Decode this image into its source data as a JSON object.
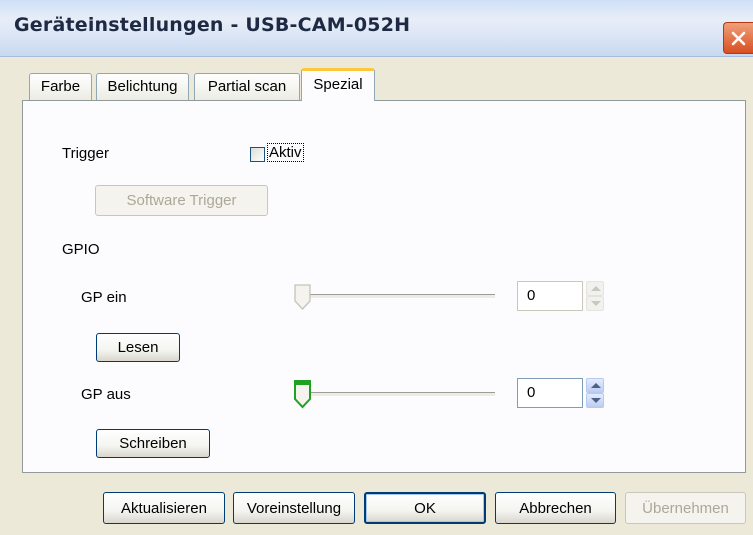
{
  "window": {
    "title": "Geräteinstellungen - USB-CAM-052H"
  },
  "tabs": [
    {
      "label": "Farbe"
    },
    {
      "label": "Belichtung"
    },
    {
      "label": "Partial scan"
    },
    {
      "label": "Spezial"
    }
  ],
  "active_tab": "Spezial",
  "trigger": {
    "label": "Trigger",
    "checkbox_label": "Aktiv",
    "checked": false,
    "software_trigger_button": "Software Trigger"
  },
  "gpio": {
    "label": "GPIO",
    "gp_ein": {
      "label": "GP ein",
      "value": "0",
      "button": "Lesen",
      "slider_level": 0
    },
    "gp_aus": {
      "label": "GP aus",
      "value": "0",
      "button": "Schreiben",
      "slider_level": 0
    }
  },
  "footer": {
    "refresh": "Aktualisieren",
    "defaults": "Voreinstellung",
    "ok": "OK",
    "cancel": "Abbrechen",
    "apply": "Übernehmen"
  },
  "colors": {
    "accent_tab": "#ffc83c",
    "close": "#d84e21",
    "slider_active": "#21a121"
  }
}
